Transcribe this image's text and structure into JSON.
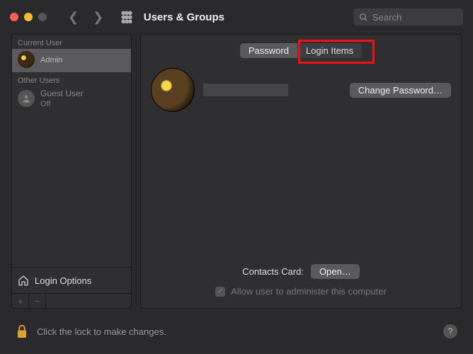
{
  "titlebar": {
    "title": "Users & Groups",
    "search_placeholder": "Search"
  },
  "sidebar": {
    "current_label": "Current User",
    "other_label": "Other Users",
    "current_user": {
      "name": "",
      "role": "Admin"
    },
    "guest_user": {
      "name": "Guest User",
      "status": "Off"
    },
    "login_options": "Login Options"
  },
  "tabs": {
    "password": "Password",
    "login_items": "Login Items"
  },
  "main": {
    "change_password": "Change Password…",
    "contacts_label": "Contacts Card:",
    "open_btn": "Open…",
    "admin_checkbox": "Allow user to administer this computer"
  },
  "footer": {
    "lock_text": "Click the lock to make changes."
  }
}
